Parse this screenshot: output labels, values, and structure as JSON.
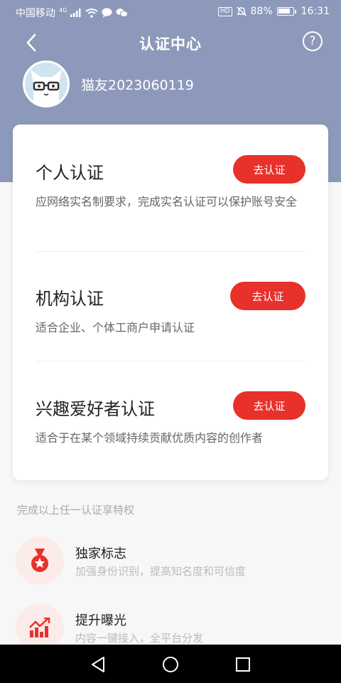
{
  "status_bar": {
    "carrier": "中国移动",
    "network": "4G",
    "battery": "88%",
    "battery_level": 0.88,
    "time": "16:31"
  },
  "header": {
    "title": "认证中心",
    "back_icon": "chevron-left-icon",
    "help_icon": "question-circle-icon"
  },
  "profile": {
    "username": "猫友2023060119",
    "avatar_icon": "cat-avatar-icon"
  },
  "certifications": [
    {
      "title": "个人认证",
      "desc": "应网络实名制要求，完成实名认证可以保护账号安全",
      "button": "去认证"
    },
    {
      "title": "机构认证",
      "desc": "适合企业、个体工商户申请认证",
      "button": "去认证"
    },
    {
      "title": "兴趣爱好者认证",
      "desc": "适合于在某个领域持续贡献优质内容的创作者",
      "button": "去认证"
    }
  ],
  "perks": {
    "section_title": "完成以上任一认证享特权",
    "items": [
      {
        "title": "独家标志",
        "desc": "加强身份识别，提高知名度和可信度",
        "icon": "medal-icon"
      },
      {
        "title": "提升曝光",
        "desc": "内容一键接入，全平台分发",
        "icon": "trend-chart-icon"
      }
    ]
  },
  "colors": {
    "header_bg": "#8c99ba",
    "accent": "#e8312b",
    "perk_icon_bg": "#fbecea"
  }
}
